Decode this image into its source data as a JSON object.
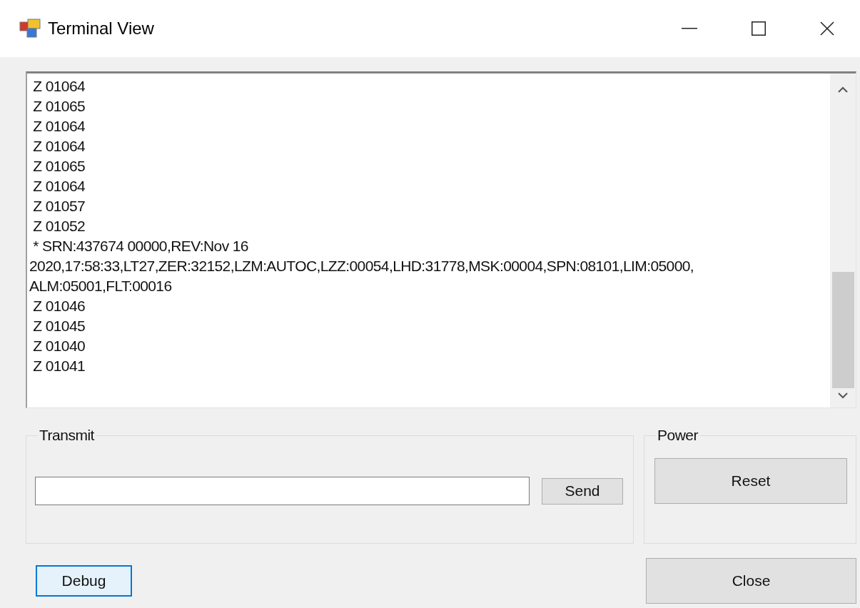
{
  "window": {
    "title": "Terminal View"
  },
  "output": {
    "lines": [
      " Z 01064",
      " Z 01065",
      " Z 01064",
      " Z 01064",
      " Z 01065",
      " Z 01064",
      " Z 01057",
      " Z 01052",
      " * SRN:437674 00000,REV:Nov 16",
      "2020,17:58:33,LT27,ZER:32152,LZM:AUTOC,LZZ:00054,LHD:31778,MSK:00004,SPN:08101,LIM:05000,",
      "ALM:05001,FLT:00016",
      " Z 01046",
      " Z 01045",
      " Z 01040",
      " Z 01041"
    ]
  },
  "transmit": {
    "title": "Transmit",
    "send_button": "Send"
  },
  "power": {
    "title": "Power",
    "reset_button": "Reset"
  },
  "buttons": [
    {
      "label": "Debug",
      "focused": true
    },
    {
      "label": "Close",
      "focused": false
    }
  ]
}
